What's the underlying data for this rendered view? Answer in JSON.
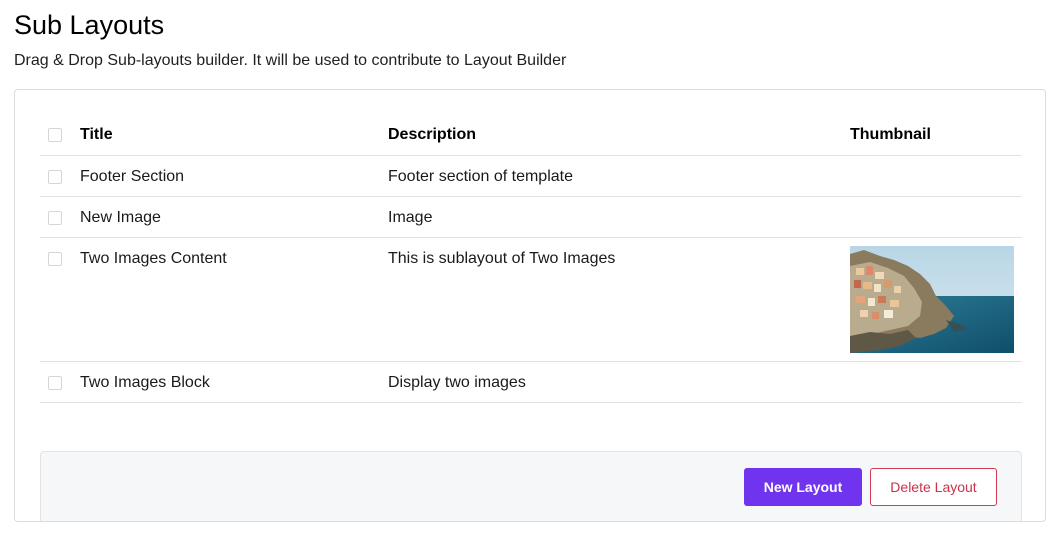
{
  "page": {
    "title": "Sub Layouts",
    "subtitle": "Drag & Drop Sub-layouts builder. It will be used to contribute to Layout Builder"
  },
  "table": {
    "columns": {
      "title": "Title",
      "description": "Description",
      "thumbnail": "Thumbnail"
    },
    "rows": [
      {
        "title": "Footer Section",
        "description": "Footer section of template",
        "has_thumbnail": false,
        "selected": false
      },
      {
        "title": "New Image",
        "description": "Image",
        "has_thumbnail": false,
        "selected": false
      },
      {
        "title": "Two Images Content",
        "description": "This is sublayout of Two Images",
        "has_thumbnail": true,
        "thumbnail_icon": "coastal-village-image",
        "selected": false
      },
      {
        "title": "Two Images Block",
        "description": "Display two images",
        "has_thumbnail": false,
        "selected": false
      }
    ]
  },
  "actions": {
    "new_label": "New Layout",
    "delete_label": "Delete Layout"
  },
  "colors": {
    "primary": "#7034ee",
    "danger": "#c9324a",
    "border": "#dcdcdc",
    "panel_bg": "#f6f7f9"
  }
}
